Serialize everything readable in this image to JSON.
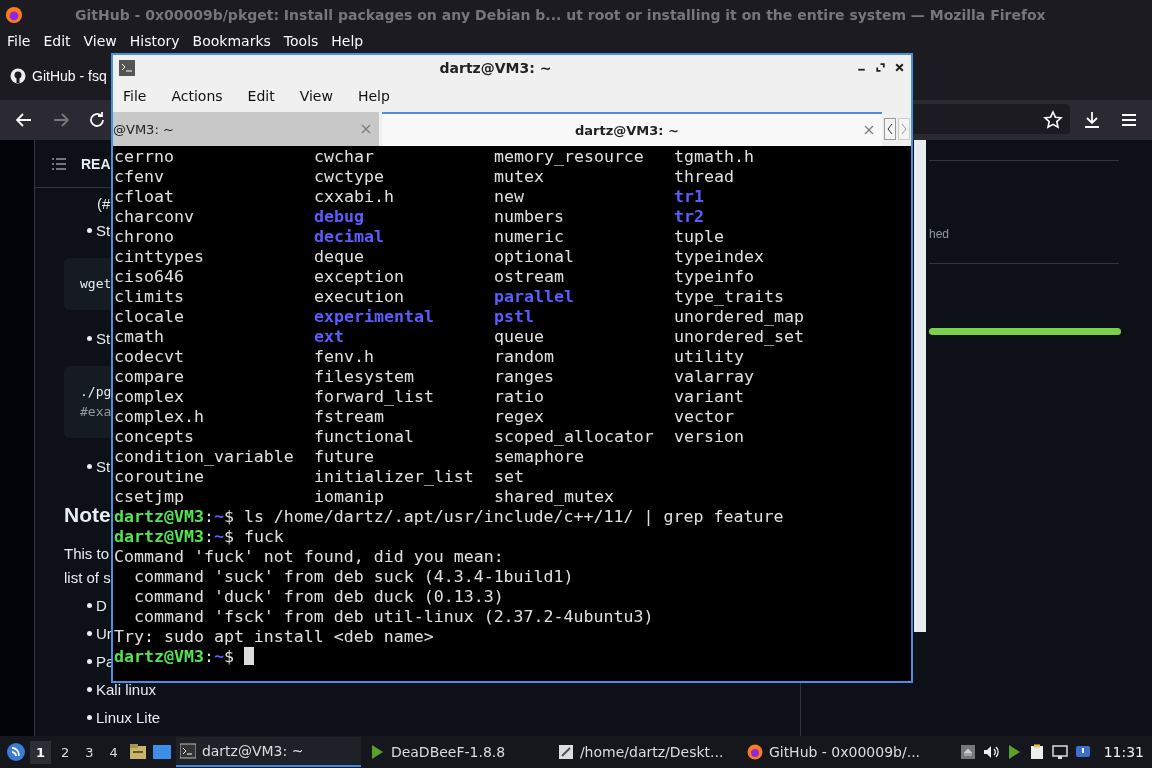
{
  "firefox": {
    "title": "GitHub - 0x00009b/pkget: Install packages on any Debian b... ut root or installing it on the entire system — Mozilla Firefox",
    "menu": [
      "File",
      "Edit",
      "View",
      "History",
      "Bookmarks",
      "Tools",
      "Help"
    ],
    "tab": "GitHub - fsq",
    "page": {
      "toc_label": "REA",
      "left_items": [
        {
          "kind": "text",
          "text": "(#"
        },
        {
          "kind": "bullet",
          "text": "St"
        },
        {
          "kind": "code",
          "lines": [
            "wget"
          ]
        },
        {
          "kind": "bullet",
          "text": "St"
        },
        {
          "kind": "code",
          "lines": [
            "./pg",
            "#exa"
          ]
        },
        {
          "kind": "bullet",
          "text": "St"
        },
        {
          "kind": "heading",
          "text": "Note"
        },
        {
          "kind": "para",
          "text": "This to"
        },
        {
          "kind": "para",
          "text": "list of s"
        },
        {
          "kind": "bullet",
          "text": "D"
        },
        {
          "kind": "bullet",
          "text": "Ur"
        },
        {
          "kind": "bullet",
          "text": "Pa"
        },
        {
          "kind": "bullet",
          "text": "Kali linux"
        },
        {
          "kind": "bullet",
          "text": "Linux Lite"
        }
      ],
      "right_text": "hed"
    }
  },
  "terminal": {
    "title": "dartz@VM3: ~",
    "menu": [
      "File",
      "Actions",
      "Edit",
      "View",
      "Help"
    ],
    "tabs": [
      {
        "label": "@VM3: ~",
        "selected": false
      },
      {
        "label": "dartz@VM3: ~",
        "selected": true
      }
    ],
    "listing": [
      [
        {
          "name": "cerrno",
          "kind": "file"
        },
        {
          "name": "cwchar",
          "kind": "file"
        },
        {
          "name": "memory_resource",
          "kind": "file"
        },
        {
          "name": "tgmath.h",
          "kind": "file"
        }
      ],
      [
        {
          "name": "cfenv",
          "kind": "file"
        },
        {
          "name": "cwctype",
          "kind": "file"
        },
        {
          "name": "mutex",
          "kind": "file"
        },
        {
          "name": "thread",
          "kind": "file"
        }
      ],
      [
        {
          "name": "cfloat",
          "kind": "file"
        },
        {
          "name": "cxxabi.h",
          "kind": "file"
        },
        {
          "name": "new",
          "kind": "file"
        },
        {
          "name": "tr1",
          "kind": "dir"
        }
      ],
      [
        {
          "name": "charconv",
          "kind": "file"
        },
        {
          "name": "debug",
          "kind": "dir"
        },
        {
          "name": "numbers",
          "kind": "file"
        },
        {
          "name": "tr2",
          "kind": "dir"
        }
      ],
      [
        {
          "name": "chrono",
          "kind": "file"
        },
        {
          "name": "decimal",
          "kind": "dir"
        },
        {
          "name": "numeric",
          "kind": "file"
        },
        {
          "name": "tuple",
          "kind": "file"
        }
      ],
      [
        {
          "name": "cinttypes",
          "kind": "file"
        },
        {
          "name": "deque",
          "kind": "file"
        },
        {
          "name": "optional",
          "kind": "file"
        },
        {
          "name": "typeindex",
          "kind": "file"
        }
      ],
      [
        {
          "name": "ciso646",
          "kind": "file"
        },
        {
          "name": "exception",
          "kind": "file"
        },
        {
          "name": "ostream",
          "kind": "file"
        },
        {
          "name": "typeinfo",
          "kind": "file"
        }
      ],
      [
        {
          "name": "climits",
          "kind": "file"
        },
        {
          "name": "execution",
          "kind": "file"
        },
        {
          "name": "parallel",
          "kind": "dir"
        },
        {
          "name": "type_traits",
          "kind": "file"
        }
      ],
      [
        {
          "name": "clocale",
          "kind": "file"
        },
        {
          "name": "experimental",
          "kind": "dir"
        },
        {
          "name": "pstl",
          "kind": "dir"
        },
        {
          "name": "unordered_map",
          "kind": "file"
        }
      ],
      [
        {
          "name": "cmath",
          "kind": "file"
        },
        {
          "name": "ext",
          "kind": "dir"
        },
        {
          "name": "queue",
          "kind": "file"
        },
        {
          "name": "unordered_set",
          "kind": "file"
        }
      ],
      [
        {
          "name": "codecvt",
          "kind": "file"
        },
        {
          "name": "fenv.h",
          "kind": "file"
        },
        {
          "name": "random",
          "kind": "file"
        },
        {
          "name": "utility",
          "kind": "file"
        }
      ],
      [
        {
          "name": "compare",
          "kind": "file"
        },
        {
          "name": "filesystem",
          "kind": "file"
        },
        {
          "name": "ranges",
          "kind": "file"
        },
        {
          "name": "valarray",
          "kind": "file"
        }
      ],
      [
        {
          "name": "complex",
          "kind": "file"
        },
        {
          "name": "forward_list",
          "kind": "file"
        },
        {
          "name": "ratio",
          "kind": "file"
        },
        {
          "name": "variant",
          "kind": "file"
        }
      ],
      [
        {
          "name": "complex.h",
          "kind": "file"
        },
        {
          "name": "fstream",
          "kind": "file"
        },
        {
          "name": "regex",
          "kind": "file"
        },
        {
          "name": "vector",
          "kind": "file"
        }
      ],
      [
        {
          "name": "concepts",
          "kind": "file"
        },
        {
          "name": "functional",
          "kind": "file"
        },
        {
          "name": "scoped_allocator",
          "kind": "file"
        },
        {
          "name": "version",
          "kind": "file"
        }
      ],
      [
        {
          "name": "condition_variable",
          "kind": "file"
        },
        {
          "name": "future",
          "kind": "file"
        },
        {
          "name": "semaphore",
          "kind": "file"
        }
      ],
      [
        {
          "name": "coroutine",
          "kind": "file"
        },
        {
          "name": "initializer_list",
          "kind": "file"
        },
        {
          "name": "set",
          "kind": "file"
        }
      ],
      [
        {
          "name": "csetjmp",
          "kind": "file"
        },
        {
          "name": "iomanip",
          "kind": "file"
        },
        {
          "name": "shared_mutex",
          "kind": "file"
        }
      ]
    ],
    "lines": [
      {
        "kind": "prompt",
        "user": "dartz@VM3",
        "sep": ":",
        "path": "~",
        "command": "$ ls /home/dartz/.apt/usr/include/c++/11/ | grep feature"
      },
      {
        "kind": "prompt",
        "user": "dartz@VM3",
        "sep": ":",
        "path": "~",
        "command": "$ fuck"
      },
      {
        "kind": "output",
        "text": "Command 'fuck' not found, did you mean:"
      },
      {
        "kind": "output",
        "text": "  command 'suck' from deb suck (4.3.4-1build1)"
      },
      {
        "kind": "output",
        "text": "  command 'duck' from deb duck (0.13.3)"
      },
      {
        "kind": "output",
        "text": "  command 'fsck' from deb util-linux (2.37.2-4ubuntu3)"
      },
      {
        "kind": "output",
        "text": "Try: sudo apt install <deb name>"
      },
      {
        "kind": "prompt",
        "user": "dartz@VM3",
        "sep": ":",
        "path": "~",
        "command": "$ ",
        "cursor": true
      }
    ]
  },
  "taskbar": {
    "workspaces": [
      {
        "label": "1",
        "selected": true
      },
      {
        "label": "2",
        "selected": false
      },
      {
        "label": "3",
        "selected": false
      },
      {
        "label": "4",
        "selected": false
      }
    ],
    "tasks": [
      {
        "label": "dartz@VM3: ~",
        "kind": "terminal",
        "selected": true
      },
      {
        "label": "DeaDBeeF-1.8.8",
        "kind": "player",
        "selected": false
      },
      {
        "label": "/home/dartz/Deskt...",
        "kind": "editor",
        "selected": false
      },
      {
        "label": "GitHub - 0x00009b/...",
        "kind": "browser",
        "selected": false
      }
    ],
    "clock": "11:31"
  }
}
